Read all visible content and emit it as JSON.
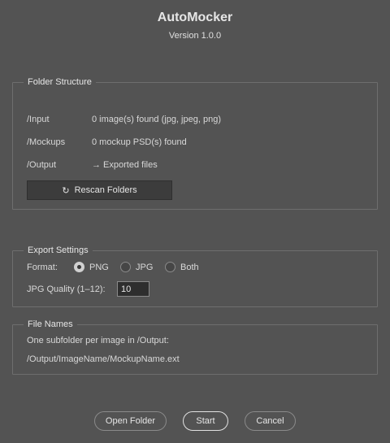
{
  "app": {
    "title": "AutoMocker",
    "version": "Version 1.0.0"
  },
  "folder_structure": {
    "legend": "Folder Structure",
    "rows": [
      {
        "key": "/Input",
        "value": "0 image(s) found (jpg, jpeg, png)"
      },
      {
        "key": "/Mockups",
        "value": "0 mockup PSD(s) found"
      },
      {
        "key": "/Output",
        "value": "→ Exported files"
      }
    ],
    "rescan_icon": "refresh-icon",
    "rescan_label": "Rescan Folders"
  },
  "export_settings": {
    "legend": "Export Settings",
    "format_label": "Format:",
    "formats": [
      {
        "label": "PNG",
        "checked": true
      },
      {
        "label": "JPG",
        "checked": false
      },
      {
        "label": "Both",
        "checked": false
      }
    ],
    "quality_label": "JPG Quality (1–12):",
    "quality_value": "10"
  },
  "file_names": {
    "legend": "File Names",
    "description": "One subfolder per image in /Output:",
    "pattern": "/Output/ImageName/MockupName.ext"
  },
  "buttons": {
    "open_folder": "Open Folder",
    "start": "Start",
    "cancel": "Cancel"
  }
}
